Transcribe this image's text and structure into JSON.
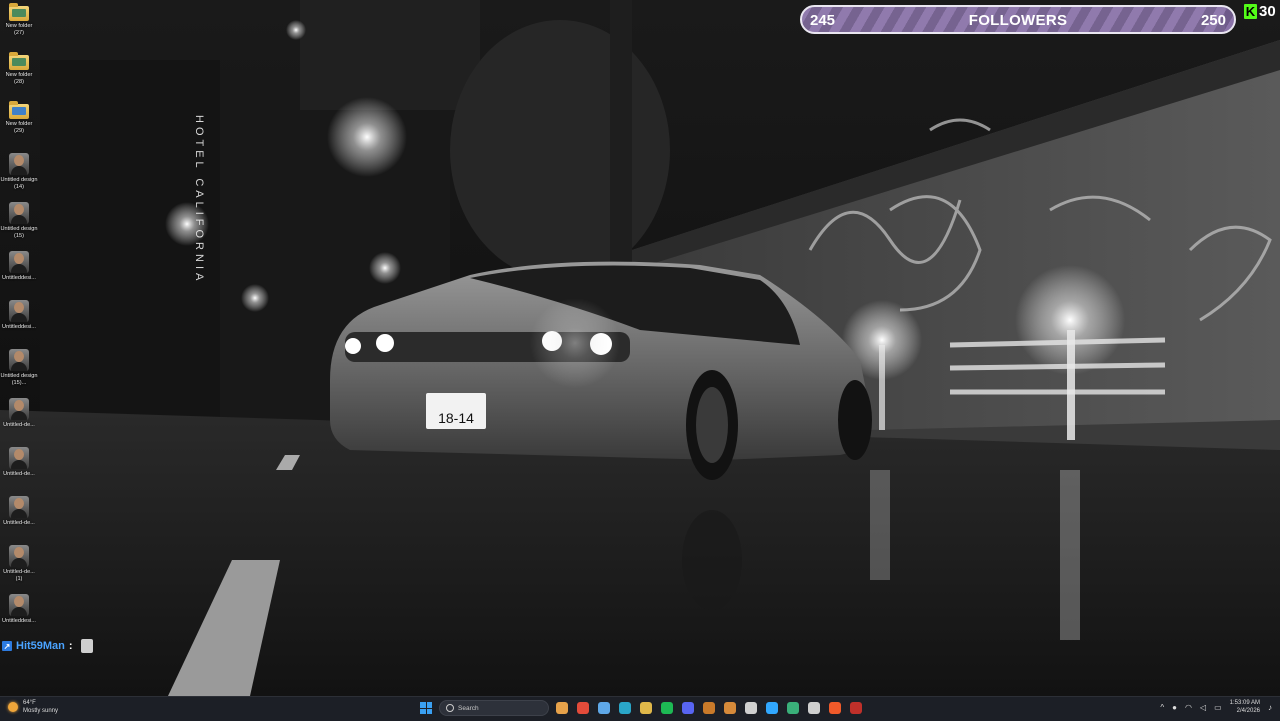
{
  "desktop": {
    "icons": [
      {
        "label": "New folder (27)",
        "kind": "folder",
        "icon": "folder-icon",
        "accent": "#4c8a5c"
      },
      {
        "label": "New folder (28)",
        "kind": "folder",
        "icon": "folder-icon",
        "accent": "#4c8a5c"
      },
      {
        "label": "New folder (29)",
        "kind": "folder",
        "icon": "folder-icon",
        "accent": "#3f80c8"
      },
      {
        "label": "Untitled design (14)",
        "kind": "image",
        "icon": "portrait-thumbnail-icon"
      },
      {
        "label": "Untitled design (15)",
        "kind": "image",
        "icon": "portrait-thumbnail-icon"
      },
      {
        "label": "Untitleddesi...",
        "kind": "image",
        "icon": "portrait-thumbnail-icon"
      },
      {
        "label": "Untitleddesi...",
        "kind": "image",
        "icon": "portrait-thumbnail-icon"
      },
      {
        "label": "Untitled design (15)...",
        "kind": "image",
        "icon": "portrait-thumbnail-icon"
      },
      {
        "label": "Untitled-de...",
        "kind": "image",
        "icon": "portrait-thumbnail-icon"
      },
      {
        "label": "Untitled-de...",
        "kind": "image",
        "icon": "portrait-thumbnail-icon"
      },
      {
        "label": "Untitled-de...",
        "kind": "image",
        "icon": "portrait-thumbnail-icon"
      },
      {
        "label": "Untitled-de... (1)",
        "kind": "image",
        "icon": "portrait-thumbnail-icon"
      },
      {
        "label": "Untitleddesi...",
        "kind": "image",
        "icon": "portrait-thumbnail-icon"
      }
    ]
  },
  "wallpaper": {
    "sign_text": "HOTEL CALIFORNIA",
    "plate_text": "18-14"
  },
  "chat": {
    "username": "Hit59Man",
    "separator": ":",
    "user_color": "#4aa3ff"
  },
  "overlay": {
    "follower_goal": {
      "current": "245",
      "label": "FOLLOWERS",
      "target": "250",
      "progress": 0.98
    },
    "kick": {
      "logo": "K",
      "count": "30",
      "brand_color": "#53fc18"
    }
  },
  "taskbar": {
    "weather": {
      "temp": "64°F",
      "condition": "Mostly sunny"
    },
    "search_placeholder": "Search",
    "apps": [
      {
        "icon": "widget-icon",
        "color": "#e7a24a"
      },
      {
        "icon": "chrome-icon",
        "color": "#e34b3a"
      },
      {
        "icon": "file-explorer-icon",
        "color": "#5fa8e8"
      },
      {
        "icon": "edge-icon",
        "color": "#2aa6c8"
      },
      {
        "icon": "folder-icon",
        "color": "#e0b84a"
      },
      {
        "icon": "spotify-icon",
        "color": "#1db954"
      },
      {
        "icon": "discord-icon",
        "color": "#5865f2"
      },
      {
        "icon": "app-icon",
        "color": "#c97a2a"
      },
      {
        "icon": "app-icon",
        "color": "#d68a3a"
      },
      {
        "icon": "github-icon",
        "color": "#d0d0d0"
      },
      {
        "icon": "photoshop-icon",
        "color": "#31a8ff"
      },
      {
        "icon": "app-icon",
        "color": "#3ab07a"
      },
      {
        "icon": "terminal-icon",
        "color": "#cfcfcf"
      },
      {
        "icon": "brave-icon",
        "color": "#f05a2a"
      },
      {
        "icon": "record-icon",
        "color": "#c0302a"
      }
    ],
    "clock": {
      "time": "1:53:09 AM",
      "date": "2/4/2026"
    }
  }
}
